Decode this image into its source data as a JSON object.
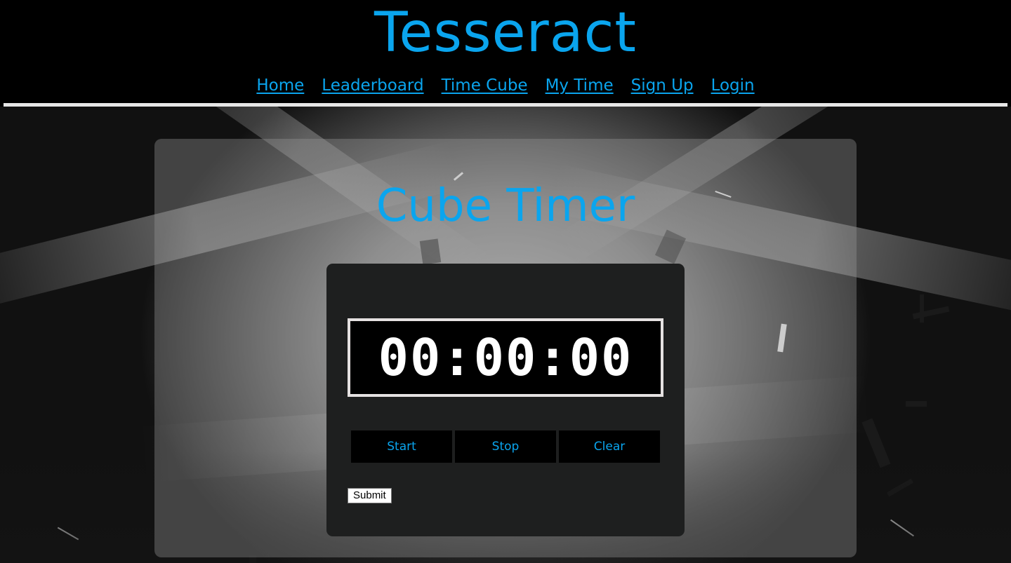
{
  "site": {
    "title": "Tesseract"
  },
  "nav": {
    "items": [
      {
        "label": "Home"
      },
      {
        "label": "Leaderboard"
      },
      {
        "label": "Time Cube"
      },
      {
        "label": "My Time"
      },
      {
        "label": "Sign Up"
      },
      {
        "label": "Login"
      }
    ]
  },
  "main": {
    "title": "Cube Timer",
    "timer": {
      "display": "00:00:00",
      "start_label": "Start",
      "stop_label": "Stop",
      "clear_label": "Clear",
      "submit_label": "Submit"
    }
  },
  "colors": {
    "accent": "#0aa5ee",
    "header_bg": "#000000",
    "card_bg": "#1e1f1f"
  }
}
